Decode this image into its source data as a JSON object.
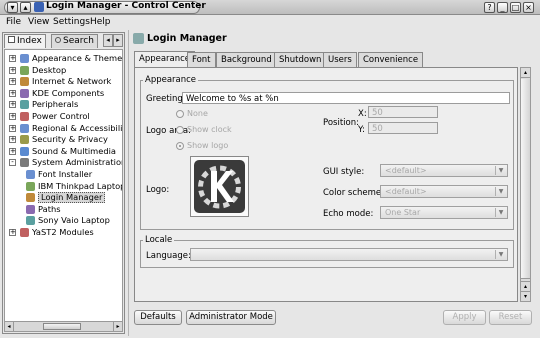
{
  "window": {
    "title": "Login Manager - Control Center"
  },
  "menubar": [
    "File",
    "View",
    "Settings",
    "Help"
  ],
  "sidebar": {
    "tabs": [
      "Index",
      "Search"
    ],
    "items": [
      {
        "label": "Appearance & Themes",
        "indent": 0,
        "exp": "+"
      },
      {
        "label": "Desktop",
        "indent": 0,
        "exp": "+"
      },
      {
        "label": "Internet & Network",
        "indent": 0,
        "exp": "+"
      },
      {
        "label": "KDE Components",
        "indent": 0,
        "exp": "+"
      },
      {
        "label": "Peripherals",
        "indent": 0,
        "exp": "+"
      },
      {
        "label": "Power Control",
        "indent": 0,
        "exp": "+"
      },
      {
        "label": "Regional & Accessibility",
        "indent": 0,
        "exp": "+"
      },
      {
        "label": "Security & Privacy",
        "indent": 0,
        "exp": "+"
      },
      {
        "label": "Sound & Multimedia",
        "indent": 0,
        "exp": "+"
      },
      {
        "label": "System Administration",
        "indent": 0,
        "exp": "-"
      },
      {
        "label": "Font Installer",
        "indent": 1,
        "exp": ""
      },
      {
        "label": "IBM Thinkpad Laptop",
        "indent": 1,
        "exp": ""
      },
      {
        "label": "Login Manager",
        "indent": 1,
        "exp": "",
        "selected": true
      },
      {
        "label": "Paths",
        "indent": 1,
        "exp": ""
      },
      {
        "label": "Sony Vaio Laptop",
        "indent": 1,
        "exp": ""
      },
      {
        "label": "YaST2 Modules",
        "indent": 0,
        "exp": "+"
      }
    ]
  },
  "header": {
    "title": "Login Manager"
  },
  "tabs": [
    "Appearance",
    "Font",
    "Background",
    "Shutdown",
    "Users",
    "Convenience"
  ],
  "appearance": {
    "group_label": "Appearance",
    "greeting_label": "Greeting:",
    "greeting_value": "Welcome to %s at %n",
    "logo_area_label": "Logo area:",
    "logo_area_options": [
      "None",
      "Show clock",
      "Show logo"
    ],
    "position_label": "Position:",
    "x_label": "X:",
    "x_value": "50",
    "y_label": "Y:",
    "y_value": "50",
    "logo_label": "Logo:",
    "gui_style_label": "GUI style:",
    "gui_style_value": "<default>",
    "color_scheme_label": "Color scheme:",
    "color_scheme_value": "<default>",
    "echo_mode_label": "Echo mode:",
    "echo_mode_value": "One Star"
  },
  "locale": {
    "group_label": "Locale",
    "language_label": "Language:",
    "language_value": ""
  },
  "buttons": {
    "defaults": "Defaults",
    "admin_mode": "Administrator Mode",
    "apply": "Apply",
    "reset": "Reset"
  }
}
